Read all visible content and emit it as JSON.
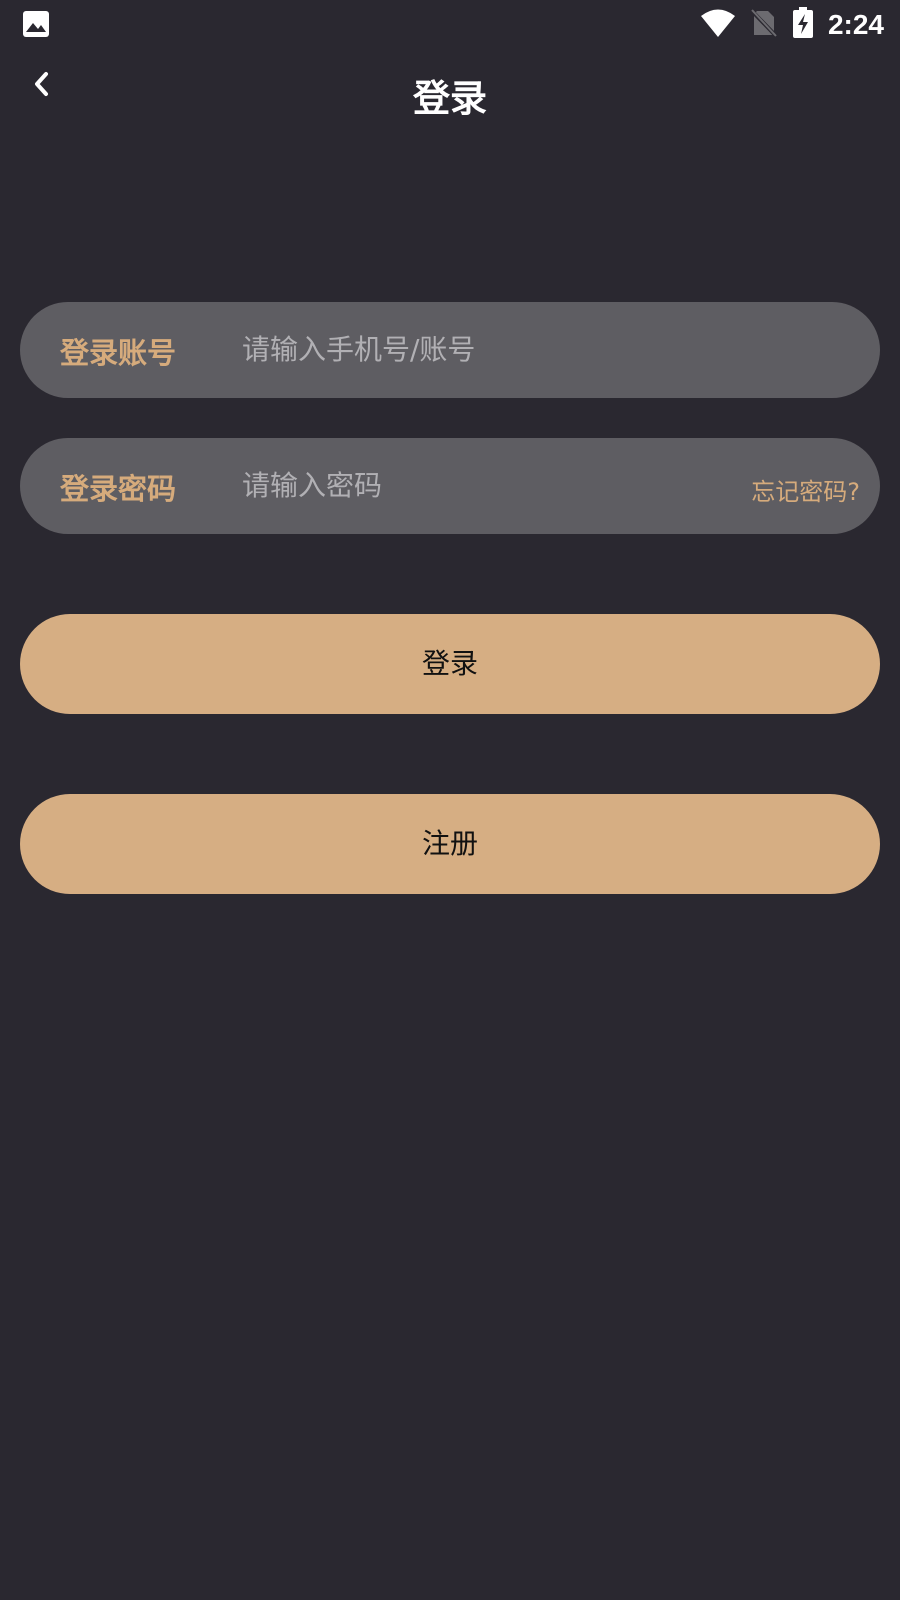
{
  "status_bar": {
    "time": "2:24",
    "left_icon": "image-icon",
    "icons": [
      "wifi-icon",
      "no-sim-icon",
      "battery-charging-icon"
    ]
  },
  "header": {
    "title": "登录",
    "back_icon": "back-chevron-icon"
  },
  "account_field": {
    "label": "登录账号",
    "placeholder": "请输入手机号/账号",
    "value": ""
  },
  "password_field": {
    "label": "登录密码",
    "placeholder": "请输入密码",
    "value": "",
    "forgot_label": "忘记密码?"
  },
  "buttons": {
    "login_label": "登录",
    "register_label": "注册"
  },
  "colors": {
    "background": "#2a2830",
    "field_background": "#5e5d62",
    "accent": "#d6ab7c",
    "button_background": "#d6ae83"
  }
}
